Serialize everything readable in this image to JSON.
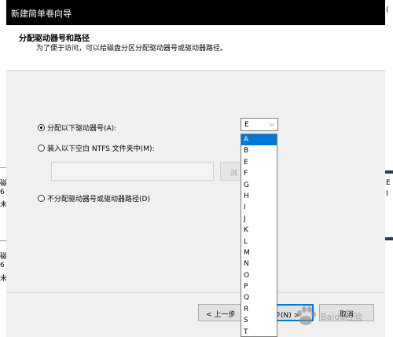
{
  "dialog": {
    "title": "新建简单卷向导",
    "header_title": "分配驱动器号和路径",
    "header_subtitle": "为了便于访问，可以给磁盘分区分配驱动器号或驱动器路径。"
  },
  "options": {
    "assign_letter": "分配以下驱动器号(A):",
    "mount_folder": "装入以下空白 NTFS 文件夹中(M):",
    "no_assign": "不分配驱动器号或驱动器路径(D)",
    "selected": "assign_letter"
  },
  "drive_select": {
    "value": "E",
    "options": [
      "A",
      "B",
      "E",
      "F",
      "G",
      "H",
      "I",
      "J",
      "K",
      "L",
      "M",
      "N",
      "O",
      "P",
      "Q",
      "R",
      "S",
      "T"
    ],
    "highlighted": "A"
  },
  "mount": {
    "path_value": "",
    "browse_label": "浏"
  },
  "buttons": {
    "back": "< 上一步",
    "next": "步(N) >",
    "cancel": "取消"
  },
  "watermark": {
    "text": "Baidu经验"
  },
  "background": {
    "left_chars": [
      "磁",
      "6",
      "未",
      "磁",
      "6",
      "未"
    ],
    "right_chars": [
      "(",
      "E",
      "I"
    ]
  }
}
